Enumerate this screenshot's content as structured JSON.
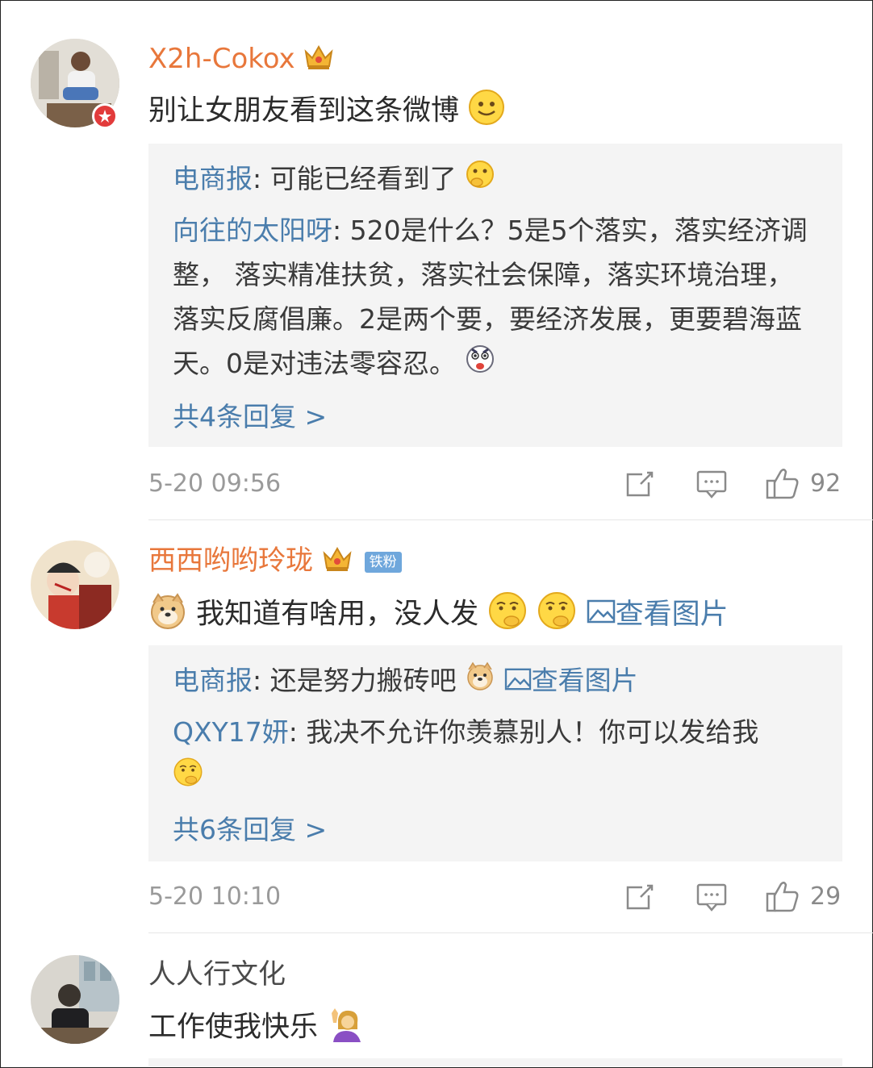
{
  "comments": [
    {
      "username": "X2h-Cokox",
      "text": "别让女朋友看到这条微博",
      "replies": [
        {
          "user": "电商报",
          "text": "可能已经看到了"
        },
        {
          "user": "向往的太阳呀",
          "text": "520是什么？5是5个落实，落实经济调整， 落实精准扶贫，落实社会保障，落实环境治理，落实反腐倡廉。2是两个要，要经济发展，更要碧海蓝天。0是对违法零容忍。"
        }
      ],
      "more_replies": "共4条回复 >",
      "time": "5-20 09:56",
      "likes": "92"
    },
    {
      "username": "西西哟哟玲珑",
      "badge": "铁粉",
      "text": "我知道有啥用，没人发",
      "view_image": "查看图片",
      "replies": [
        {
          "user": "电商报",
          "text": "还是努力搬砖吧",
          "view_image": "查看图片"
        },
        {
          "user": "QXY17妍",
          "text": "我决不允许你羡慕别人！你可以发给我"
        }
      ],
      "more_replies": "共6条回复 >",
      "time": "5-20 10:10",
      "likes": "29"
    },
    {
      "username": "人人行文化",
      "text": "工作使我快乐"
    }
  ],
  "icons": {
    "share": "share-icon",
    "comment": "comment-icon",
    "like": "thumbs-up-icon",
    "crown": "crown-icon",
    "image": "image-icon"
  },
  "colors": {
    "username_vip": "#e8773b",
    "link": "#4a7dac",
    "meta": "#9a9a9a",
    "reply_bg": "#f4f4f4"
  }
}
